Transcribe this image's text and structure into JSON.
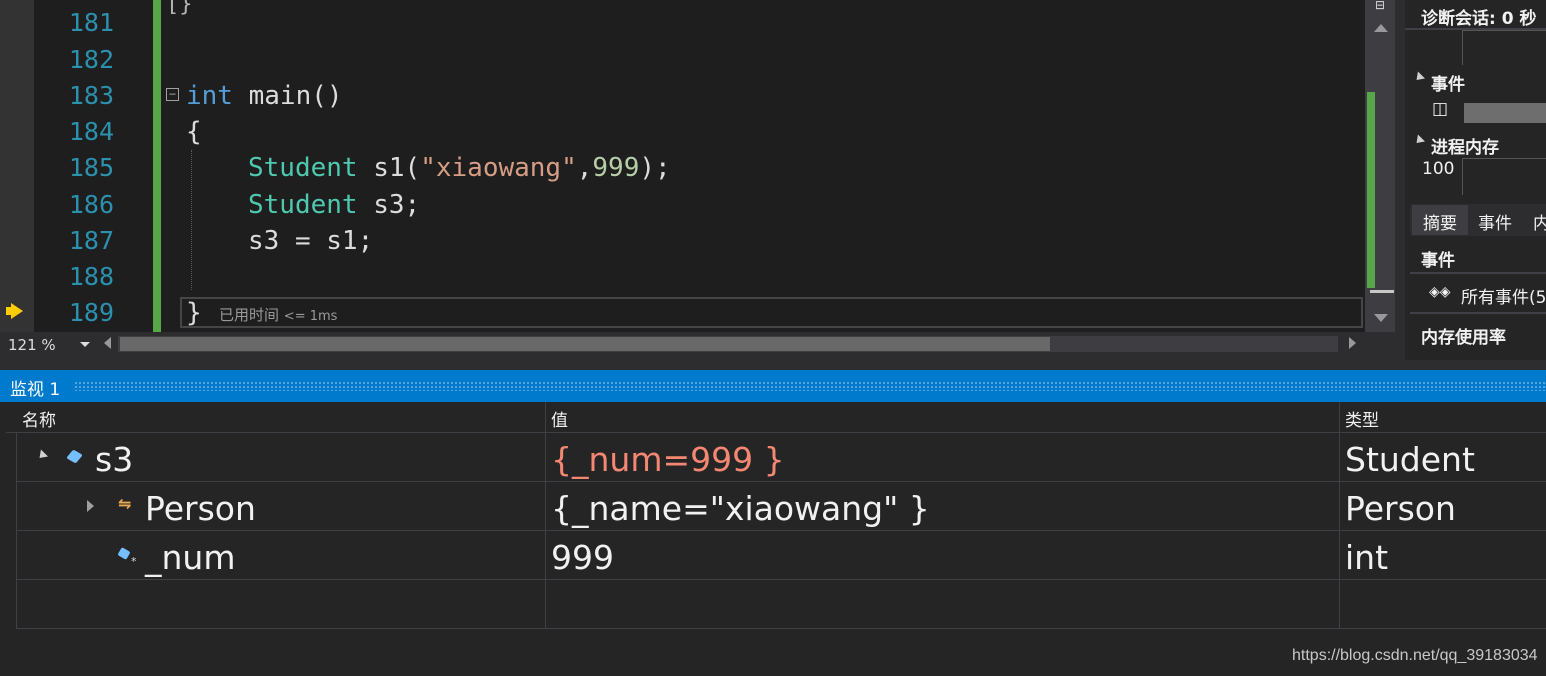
{
  "editor": {
    "line_numbers": [
      "181",
      "182",
      "183",
      "184",
      "185",
      "186",
      "187",
      "188",
      "189"
    ],
    "top_fragment": "[}",
    "lines": {
      "l183_kw": "int",
      "l183_rest": " main()",
      "l184": "{",
      "l185_type": "Student",
      "l185_a": " s1(",
      "l185_str": "\"xiaowang\"",
      "l185_comma": ",",
      "l185_num": "999",
      "l185_end": ");",
      "l186_type": "Student",
      "l186_rest": " s3;",
      "l187": "s3 = s1;",
      "l189": "}"
    },
    "collapse_glyph": "−",
    "perf_tip_label": "已用时间",
    "perf_tip_value": "<= 1ms",
    "zoom": "121 %"
  },
  "diagnostics": {
    "session": "诊断会话: 0 秒",
    "events_section": "事件",
    "pause_glyph": "◫",
    "process_memory_section": "进程内存",
    "memory_axis_value": "100",
    "tabs": [
      "摘要",
      "事件",
      "内"
    ],
    "events_header": "事件",
    "all_events": "所有事件(5",
    "memory_usage": "内存使用率"
  },
  "watch": {
    "title": "监视 1",
    "columns": [
      "名称",
      "值",
      "类型"
    ],
    "rows": [
      {
        "name": "s3",
        "value": "{_num=999 }",
        "type": "Student"
      },
      {
        "name": "Person",
        "value": "{_name=\"xiaowang\" }",
        "type": "Person"
      },
      {
        "name": "_num",
        "value": "999",
        "type": "int"
      }
    ]
  },
  "watermark": "https://blog.csdn.net/qq_39183034",
  "colors": {
    "accent": "#007acc",
    "changed_value": "#f48771",
    "keyword": "#569cd6",
    "type": "#4ec9b0",
    "string": "#d69d85",
    "number": "#b5cea8",
    "line_number": "#2b91af"
  }
}
